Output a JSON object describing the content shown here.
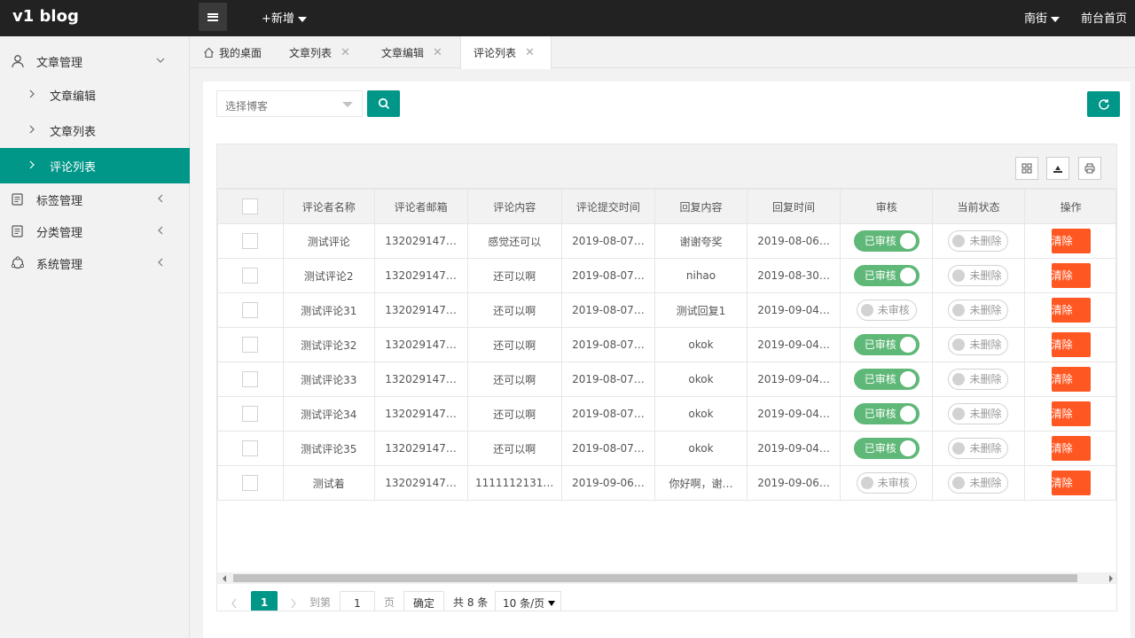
{
  "header": {
    "logo": "v1 blog",
    "add_new": "+新增",
    "user": "南街",
    "front_home": "前台首页"
  },
  "sidebar": {
    "groups": [
      {
        "label": "文章管理",
        "icon": "user-icon",
        "expanded": true
      },
      {
        "label": "标签管理",
        "icon": "tag-list-icon",
        "expanded": false
      },
      {
        "label": "分类管理",
        "icon": "category-list-icon",
        "expanded": false
      },
      {
        "label": "系统管理",
        "icon": "settings-icon",
        "expanded": false
      }
    ],
    "sub_items": [
      {
        "label": "文章编辑",
        "active": false
      },
      {
        "label": "文章列表",
        "active": false
      },
      {
        "label": "评论列表",
        "active": true
      }
    ]
  },
  "tabs": [
    {
      "label": "我的桌面",
      "closable": false,
      "active": false
    },
    {
      "label": "文章列表",
      "closable": true,
      "active": false
    },
    {
      "label": "文章编辑",
      "closable": true,
      "active": false
    },
    {
      "label": "评论列表",
      "closable": true,
      "active": true
    }
  ],
  "search": {
    "placeholder": "选择博客"
  },
  "table": {
    "columns": [
      "评论者名称",
      "评论者邮箱",
      "评论内容",
      "评论提交时间",
      "回复内容",
      "回复时间",
      "审核",
      "当前状态",
      "操作"
    ],
    "rows": [
      {
        "name": "测试评论",
        "email": "132029147…",
        "content": "感觉还可以",
        "submit_time": "2019-08-07…",
        "reply": "谢谢夸奖",
        "reply_time": "2019-08-06…",
        "review": "已审核",
        "reviewed": true,
        "status": "未删除",
        "action": "清除"
      },
      {
        "name": "测试评论2",
        "email": "132029147…",
        "content": "还可以啊",
        "submit_time": "2019-08-07…",
        "reply": "nihao",
        "reply_time": "2019-08-30…",
        "review": "已审核",
        "reviewed": true,
        "status": "未删除",
        "action": "清除"
      },
      {
        "name": "测试评论31",
        "email": "132029147…",
        "content": "还可以啊",
        "submit_time": "2019-08-07…",
        "reply": "测试回复1",
        "reply_time": "2019-09-04…",
        "review": "未审核",
        "reviewed": false,
        "status": "未删除",
        "action": "清除"
      },
      {
        "name": "测试评论32",
        "email": "132029147…",
        "content": "还可以啊",
        "submit_time": "2019-08-07…",
        "reply": "okok",
        "reply_time": "2019-09-04…",
        "review": "已审核",
        "reviewed": true,
        "status": "未删除",
        "action": "清除"
      },
      {
        "name": "测试评论33",
        "email": "132029147…",
        "content": "还可以啊",
        "submit_time": "2019-08-07…",
        "reply": "okok",
        "reply_time": "2019-09-04…",
        "review": "已审核",
        "reviewed": true,
        "status": "未删除",
        "action": "清除"
      },
      {
        "name": "测试评论34",
        "email": "132029147…",
        "content": "还可以啊",
        "submit_time": "2019-08-07…",
        "reply": "okok",
        "reply_time": "2019-09-04…",
        "review": "已审核",
        "reviewed": true,
        "status": "未删除",
        "action": "清除"
      },
      {
        "name": "测试评论35",
        "email": "132029147…",
        "content": "还可以啊",
        "submit_time": "2019-08-07…",
        "reply": "okok",
        "reply_time": "2019-09-04…",
        "review": "已审核",
        "reviewed": true,
        "status": "未删除",
        "action": "清除"
      },
      {
        "name": "测试着",
        "email": "132029147…",
        "content": "1111112131…",
        "submit_time": "2019-09-06…",
        "reply": "你好啊，谢…",
        "reply_time": "2019-09-06…",
        "review": "未审核",
        "reviewed": false,
        "status": "未删除",
        "action": "清除"
      }
    ]
  },
  "pagination": {
    "current_page": "1",
    "goto_label": "到第",
    "goto_value": "1",
    "page_unit": "页",
    "confirm": "确定",
    "total": "共 8 条",
    "page_size": "10 条/页"
  },
  "colors": {
    "accent": "#009688",
    "header_bg": "#222222",
    "switch_on": "#5fb878",
    "danger": "#ff5722"
  }
}
